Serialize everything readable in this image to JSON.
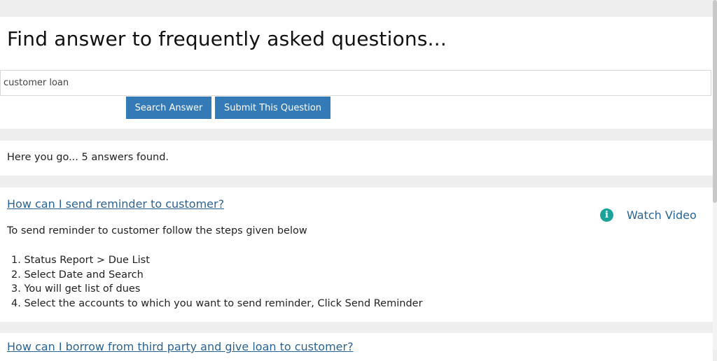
{
  "header": {
    "title": "Find answer to frequently asked questions..."
  },
  "search": {
    "value": "customer loan",
    "search_button": "Search Answer",
    "submit_button": "Submit This Question"
  },
  "results": {
    "summary": "Here you go... 5 answers found."
  },
  "answers": [
    {
      "question": "How can I send reminder to customer?",
      "watch_video": "Watch Video",
      "intro": "To send reminder to customer follow the steps given below",
      "steps": [
        "1. Status Report > Due List",
        "2. Select Date and Search",
        "3. You will get list of dues",
        "4. Select the accounts to which you want to send reminder, Click Send Reminder"
      ]
    },
    {
      "question": "How can I borrow from third party and give loan to customer?"
    }
  ],
  "icons": {
    "info": "info-icon"
  },
  "colors": {
    "button": "#337ab7",
    "link": "#2a6496",
    "info_icon": "#1aa39a"
  }
}
